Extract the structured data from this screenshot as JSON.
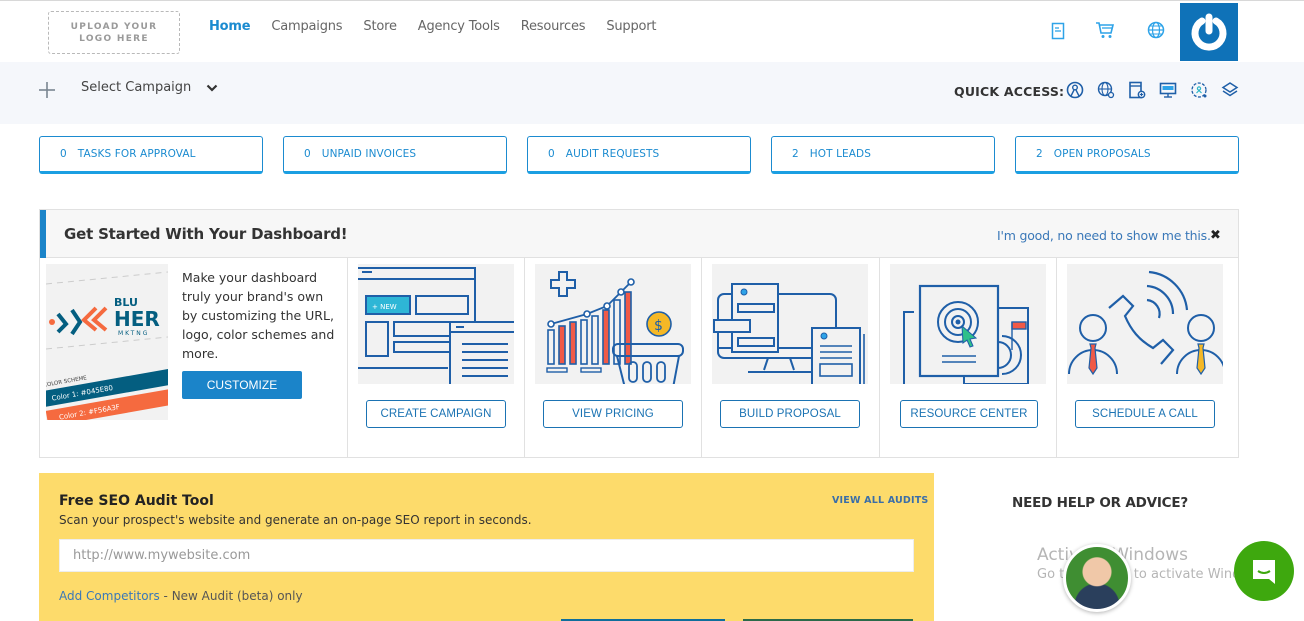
{
  "header": {
    "logo_line1": "UPLOAD YOUR",
    "logo_line2": "LOGO HERE",
    "nav": [
      {
        "label": "Home",
        "active": true
      },
      {
        "label": "Campaigns",
        "active": false
      },
      {
        "label": "Store",
        "active": false
      },
      {
        "label": "Agency Tools",
        "active": false
      },
      {
        "label": "Resources",
        "active": false
      },
      {
        "label": "Support",
        "active": false
      }
    ],
    "icons": [
      "invoice-icon",
      "cart-icon",
      "globe-icon"
    ],
    "account_icon": "power-icon"
  },
  "subbar": {
    "add_icon": "plus-icon",
    "select_campaign": "Select Campaign",
    "quick_access_label": "QUICK ACCESS:",
    "quick_access_icons": [
      "user-circle-icon",
      "globe-settings-icon",
      "document-add-icon",
      "monitor-icon",
      "search-user-icon",
      "layers-icon"
    ]
  },
  "stats": [
    {
      "count": "0",
      "label": "TASKS FOR APPROVAL"
    },
    {
      "count": "0",
      "label": "UNPAID INVOICES"
    },
    {
      "count": "0",
      "label": "AUDIT REQUESTS"
    },
    {
      "count": "2",
      "label": "HOT LEADS"
    },
    {
      "count": "2",
      "label": "OPEN PROPOSALS"
    }
  ],
  "get_started": {
    "title": "Get Started With Your Dashboard!",
    "dismiss": "I'm good, no need to show me this.",
    "close": "✖",
    "brand": {
      "text": "Make your dashboard truly your brand's own by customizing the URL, logo, color schemes and more.",
      "button": "CUSTOMIZE",
      "image": {
        "brand_line1": "BLU",
        "brand_line2": "HER",
        "brand_line3": "MKTNG",
        "scheme_label": "COLOR SCHEME",
        "color1": "Color 1: #045E80",
        "color2": "Color 2: #F56A3F"
      }
    },
    "cards": [
      {
        "button": "CREATE CAMPAIGN",
        "image_badge": "+ NEW"
      },
      {
        "button": "VIEW PRICING",
        "image_badge": "$"
      },
      {
        "button": "BUILD PROPOSAL"
      },
      {
        "button": "RESOURCE CENTER"
      },
      {
        "button": "SCHEDULE A CALL"
      }
    ]
  },
  "seo": {
    "title": "Free SEO Audit Tool",
    "subtitle": "Scan your prospect's website and generate an on-page SEO report in seconds.",
    "view_all": "VIEW ALL AUDITS",
    "input_placeholder": "http://www.mywebsite.com",
    "input_value": "",
    "add_competitors": "Add Competitors",
    "footer_rest": " - New Audit (beta) only"
  },
  "help": {
    "title": "NEED HELP OR ADVICE?"
  },
  "watermark": {
    "line1": "Activate Windows",
    "line2": "Go to Settings to activate Windows."
  },
  "colors": {
    "accent": "#1b8bd0",
    "primary_button": "#1b84c9",
    "seo_bg": "#fddb6b",
    "chat_green": "#3ea80e",
    "account_blue": "#0f72b8"
  }
}
